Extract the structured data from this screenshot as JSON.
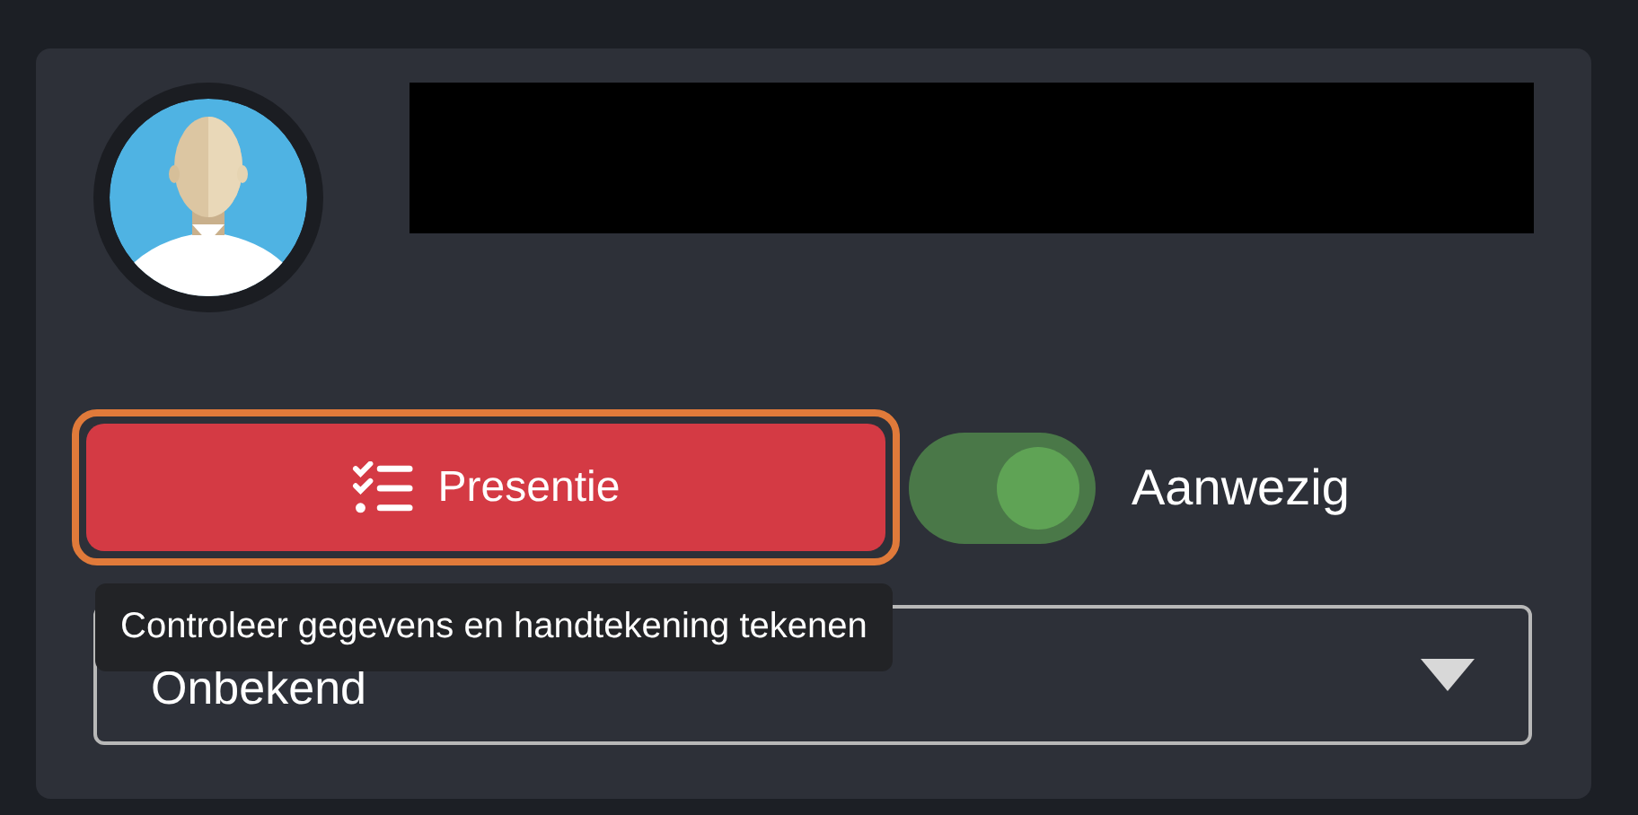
{
  "profile": {
    "name_redacted": true
  },
  "presence_button": {
    "label": "Presentie",
    "focused": true
  },
  "attendance_toggle": {
    "label": "Aanwezig",
    "on": true
  },
  "status_select": {
    "value": "Onbekend"
  },
  "tooltip": {
    "text": "Controleer gegevens en handtekening tekenen"
  }
}
